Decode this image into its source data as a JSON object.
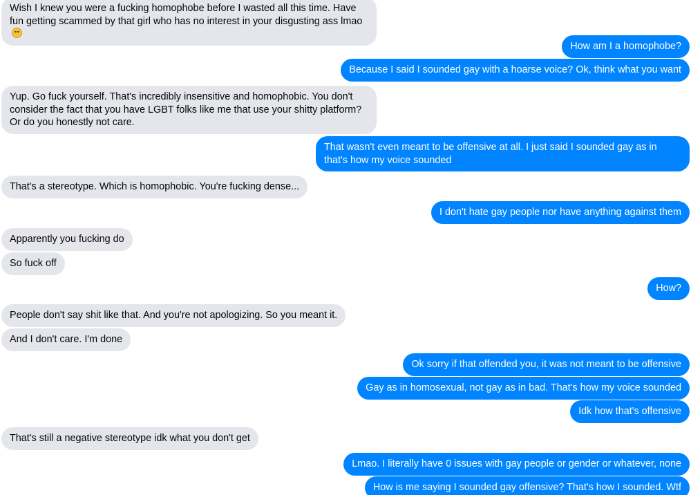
{
  "messages": {
    "m1": {
      "text": "Wish I knew you were a fucking homophobe before I wasted all this time. Have fun getting scammed by that girl who has no interest in your disgusting ass lmao",
      "emoji": "rolling-on-floor-laughing"
    },
    "m2": {
      "text": "How am I a homophobe?"
    },
    "m3": {
      "text": "Because I said I sounded gay with a hoarse voice? Ok, think what you want"
    },
    "m4": {
      "text": "Yup. Go fuck yourself. That's incredibly insensitive and homophobic. You don't consider the fact that you have LGBT folks like me that use your shitty platform? Or do you honestly not care."
    },
    "m5": {
      "text": "That wasn't even meant to be offensive at all. I just said I sounded gay as in that's how my voice sounded"
    },
    "m6": {
      "text": "That's a stereotype. Which is homophobic. You're fucking dense..."
    },
    "m7": {
      "text": "I don't hate gay people nor have anything against them"
    },
    "m8": {
      "text": "Apparently you fucking do"
    },
    "m9": {
      "text": "So fuck off"
    },
    "m10": {
      "text": "How?"
    },
    "m11": {
      "text": "People don't say shit like that. And you're not apologizing. So you meant it."
    },
    "m12": {
      "text": "And I don't care. I'm done"
    },
    "m13": {
      "text": "Ok sorry if that offended you, it was not meant to be offensive"
    },
    "m14": {
      "text": "Gay as in homosexual, not gay as in bad. That's how my voice sounded"
    },
    "m15": {
      "text": "Idk how that's offensive"
    },
    "m16": {
      "text": "That's still a negative stereotype idk what you don't get"
    },
    "m17": {
      "text": "Lmao. I literally have 0 issues with gay people or gender or whatever, none"
    },
    "m18": {
      "text": "How is me saying I sounded gay offensive? That's how I sounded. Wtf"
    }
  },
  "colors": {
    "incoming_bubble": "#e4e6eb",
    "outgoing_bubble": "#0084ff",
    "incoming_text": "#050505",
    "outgoing_text": "#ffffff"
  }
}
